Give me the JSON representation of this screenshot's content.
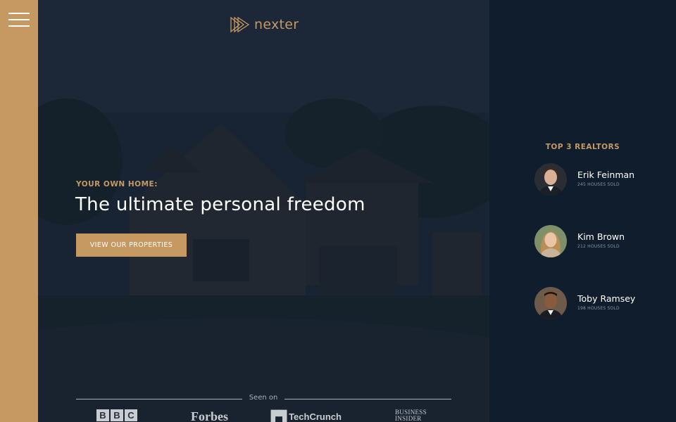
{
  "sidebar": {
    "menu_icon": "hamburger-menu-icon"
  },
  "header": {
    "logo_text": "nexter",
    "logo_icon": "play-logo-icon",
    "subtitle": "YOUR OWN HOME:",
    "heading": "The ultimate personal freedom",
    "cta_label": "VIEW OUR PROPERTIES",
    "seen_on": "Seen on",
    "press": {
      "bbc": [
        "B",
        "B",
        "C"
      ],
      "forbes": "Forbes",
      "techcrunch": "TechCrunch",
      "business_insider": [
        "BUSINESS",
        "INSIDER"
      ]
    }
  },
  "realtors": {
    "title": "TOP 3 REALTORS",
    "items": [
      {
        "name": "Erik Feinman",
        "sold": "245 HOUSES SOLD"
      },
      {
        "name": "Kim Brown",
        "sold": "212 HOUSES SOLD"
      },
      {
        "name": "Toby Ramsey",
        "sold": "198 HOUSES SOLD"
      }
    ]
  },
  "colors": {
    "primary": "#c69963",
    "dark": "#101d2c",
    "grey": "#aab0b8"
  }
}
